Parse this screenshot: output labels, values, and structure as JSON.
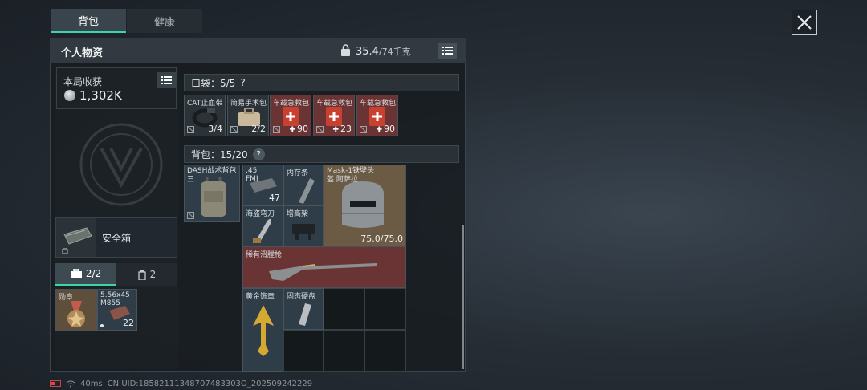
{
  "tabs": [
    {
      "label": "背包",
      "active": true
    },
    {
      "label": "健康",
      "active": false
    }
  ],
  "panel": {
    "title": "个人物资",
    "weight_current": "35.4",
    "weight_max": "/74千克"
  },
  "harvest": {
    "label": "本局收获",
    "value": "1,302K"
  },
  "safe_box": {
    "label": "安全箱"
  },
  "sub_tabs": [
    {
      "label": "2/2",
      "icon": "briefcase-icon"
    },
    {
      "label": "2",
      "icon": "bottle-icon"
    }
  ],
  "side_items": [
    {
      "name": "勋章",
      "count": ""
    },
    {
      "name": "5.56x45 M855",
      "count": "22"
    }
  ],
  "pocket": {
    "label": "口袋：5/5",
    "help": "?",
    "items": [
      {
        "name": "CAT止血带",
        "count": "3/4",
        "plus": false
      },
      {
        "name": "简易手术包",
        "count": "2/2",
        "plus": false
      },
      {
        "name": "车载急救包",
        "count": "90",
        "plus": true
      },
      {
        "name": "车载急救包",
        "count": "23",
        "plus": true
      },
      {
        "name": "车载急救包",
        "count": "90",
        "plus": true
      }
    ]
  },
  "backpack": {
    "label": "背包：15/20",
    "help": "?",
    "items": [
      {
        "name": "DASH战术背包 三",
        "count": ""
      },
      {
        "name": ".45 FMJ",
        "count": "47"
      },
      {
        "name": "内存条",
        "count": ""
      },
      {
        "name": "Mask-1铁壁头盔 阿萨拉",
        "count": "75.0/75.0"
      },
      {
        "name": "海盗弯刀",
        "count": ""
      },
      {
        "name": "增高架",
        "count": ""
      },
      {
        "name": "稀有滑膛枪",
        "count": ""
      },
      {
        "name": "黄金饰章",
        "count": ""
      },
      {
        "name": "固态硬盘",
        "count": ""
      }
    ]
  },
  "status": {
    "ping": "40ms",
    "uid": "CN UID:18582111348707483303O_202509242229"
  },
  "colors": {
    "accent": "#3bd6a6",
    "gold_tier": "#6b5a44",
    "red_tier": "#6b3434",
    "blue_tier": "#2f3d48"
  }
}
